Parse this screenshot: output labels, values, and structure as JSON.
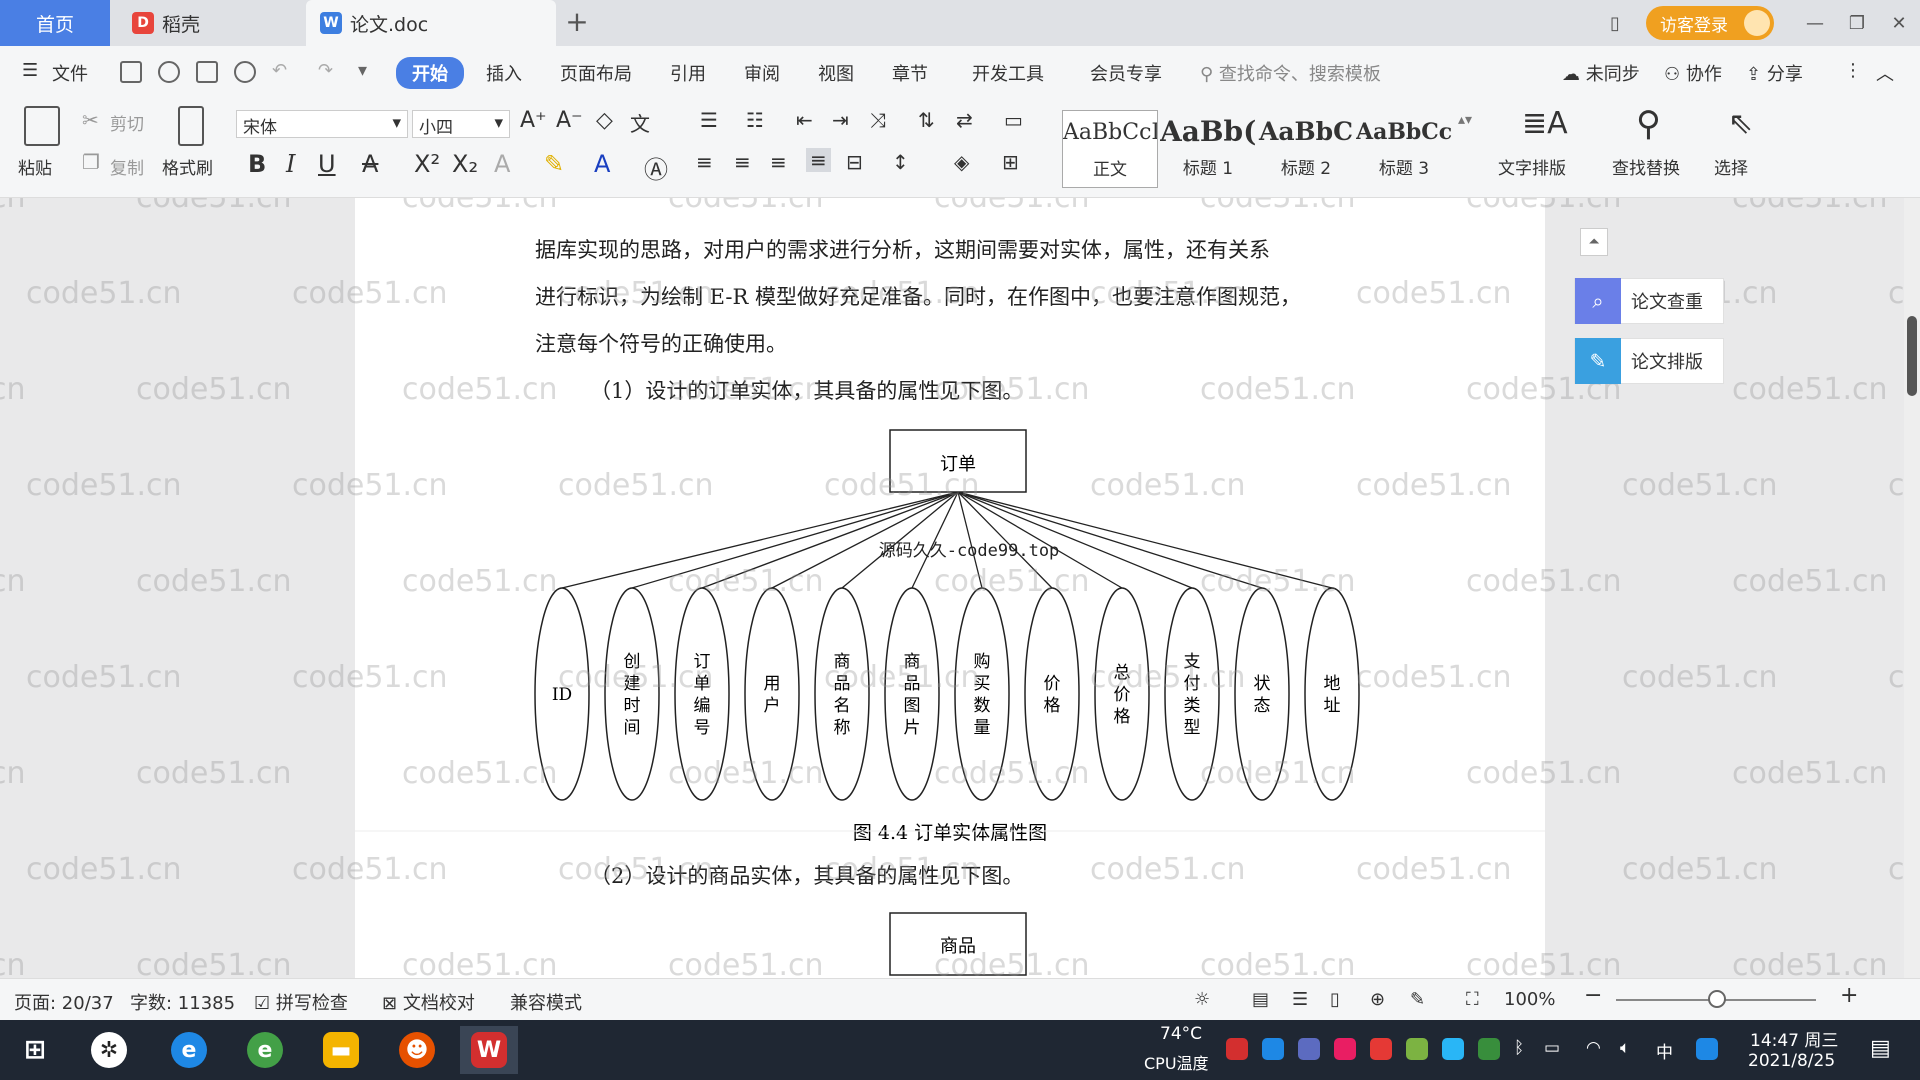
{
  "tabs": {
    "home": "首页",
    "daoke": "稻壳",
    "doc": "论文.doc",
    "new": "+"
  },
  "window": {
    "login_label": "访客登录",
    "minimize": "—",
    "restore": "❐",
    "close": "✕"
  },
  "menu": {
    "file": "文件",
    "items": [
      "开始",
      "插入",
      "页面布局",
      "引用",
      "审阅",
      "视图",
      "章节",
      "开发工具",
      "会员专享"
    ],
    "search_placeholder": "查找命令、搜索模板",
    "sync": "未同步",
    "collab": "协作",
    "share": "分享"
  },
  "ribbon": {
    "paste": "粘贴",
    "cut": "剪切",
    "copy": "复制",
    "format_painter": "格式刷",
    "font_name": "宋体",
    "font_size": "小四",
    "styles": [
      {
        "preview": "AaBbCcI",
        "label": "正文"
      },
      {
        "preview": "AaBb(",
        "label": "标题 1"
      },
      {
        "preview": "AaBbC",
        "label": "标题 2"
      },
      {
        "preview": "AaBbCcI",
        "label": "标题 3"
      }
    ],
    "text_layout": "文字排版",
    "find_replace": "查找替换",
    "select": "选择"
  },
  "document": {
    "lines": [
      "据库实现的思路，对用户的需求进行分析，这期间需要对实体，属性，还有关系",
      "进行标识，为绘制 E-R 模型做好充足准备。同时，在作图中，也要注意作图规范，",
      "注意每个符号的正确使用。",
      "（1）设计的订单实体，其具备的属性见下图。"
    ],
    "entity1": "订单",
    "attributes1": [
      "ID",
      "创建时间",
      "订单编号",
      "用户",
      "商品名称",
      "商品图片",
      "购买数量",
      "价格",
      "总价格",
      "支付类型",
      "状态",
      "地址"
    ],
    "overlay_text": "源码久久-code99.top",
    "caption1": "图 4.4  订单实体属性图",
    "line2": "（2）设计的商品实体，其具备的属性见下图。",
    "entity2": "商品",
    "watermark": "code51.cn"
  },
  "side_panel": {
    "check": "论文查重",
    "layout": "论文排版"
  },
  "status": {
    "page": "页面: 20/37",
    "words": "字数: 11385",
    "spell": "拼写检查",
    "proof": "文档校对",
    "compat": "兼容模式",
    "zoom": "100%"
  },
  "taskbar": {
    "cpu_temp": "74°C",
    "cpu_label": "CPU温度",
    "ime": "中",
    "time": "14:47 周三",
    "date": "2021/8/25"
  },
  "colors": {
    "accent": "#4a7fe4",
    "login": "#f0a020",
    "side_check": "#6a7fe8",
    "side_layout": "#3aa0e0"
  }
}
